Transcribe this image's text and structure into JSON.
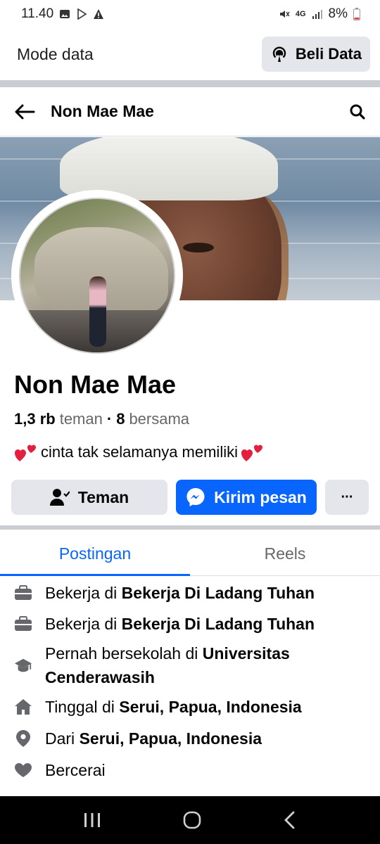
{
  "status_bar": {
    "time": "11.40",
    "network": "4G",
    "battery": "8%"
  },
  "data_bar": {
    "label": "Mode data",
    "button_label": "Beli Data"
  },
  "header": {
    "title": "Non Mae Mae"
  },
  "profile": {
    "name": "Non Mae Mae",
    "friends_count": "1,3 rb",
    "friends_word": "teman",
    "separator": "·",
    "mutual_count": "8",
    "mutual_word": "bersama",
    "bio": "cinta tak selamanya memiliki"
  },
  "actions": {
    "friend_label": "Teman",
    "message_label": "Kirim pesan",
    "more_label": "···"
  },
  "tabs": [
    {
      "label": "Postingan"
    },
    {
      "label": "Reels"
    }
  ],
  "details": [
    {
      "icon": "briefcase-icon",
      "prefix": "Bekerja di ",
      "value": "Bekerja Di Ladang Tuhan"
    },
    {
      "icon": "briefcase-icon",
      "prefix": "Bekerja di ",
      "value": "Bekerja Di Ladang Tuhan"
    },
    {
      "icon": "graduation-cap-icon",
      "prefix": "Pernah bersekolah di ",
      "value": "Universitas Cenderawasih"
    },
    {
      "icon": "home-icon",
      "prefix": "Tinggal di ",
      "value": "Serui, Papua, Indonesia"
    },
    {
      "icon": "location-pin-icon",
      "prefix": "Dari ",
      "value": "Serui, Papua, Indonesia"
    },
    {
      "icon": "heart-icon",
      "prefix": "",
      "value": "Bercerai"
    }
  ],
  "colors": {
    "accent": "#0866ff",
    "button_gray": "#e4e6eb",
    "muted_text": "#65676b"
  }
}
